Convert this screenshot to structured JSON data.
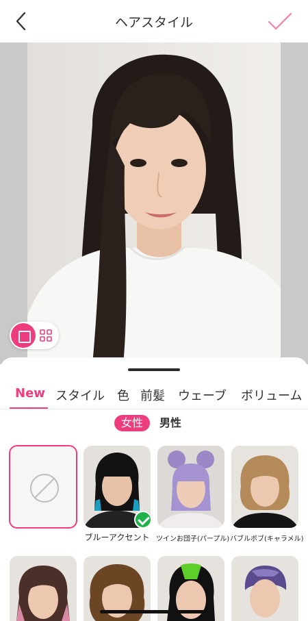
{
  "header": {
    "title": "ヘアスタイル",
    "back_icon": "chevron-left-icon",
    "confirm_icon": "checkmark-icon",
    "accent_color": "#ee3d7e"
  },
  "view_toggle": {
    "single_icon": "square-icon",
    "grid_icon": "grid-icon",
    "selected": "single"
  },
  "tabs": [
    {
      "label": "New",
      "active": true
    },
    {
      "label": "スタイル",
      "active": false
    },
    {
      "label": "色",
      "active": false
    },
    {
      "label": "前髪",
      "active": false
    },
    {
      "label": "ウェーブ",
      "active": false
    },
    {
      "label": "ボリューム",
      "active": false
    }
  ],
  "gender": {
    "female": "女性",
    "male": "男性",
    "selected": "女性"
  },
  "styles_row1": [
    {
      "label": "",
      "icon": "none-icon",
      "selected": true
    },
    {
      "label": "ブルーアクセント",
      "applied": true
    },
    {
      "label": "ツインお団子(パープル)"
    },
    {
      "label": "バブルボブ(キャラメル)"
    }
  ],
  "styles_row2_icons": [
    "pink-highlight-hair",
    "brown-wavy-hair",
    "green-roots-hair",
    "purple-short-hair"
  ]
}
